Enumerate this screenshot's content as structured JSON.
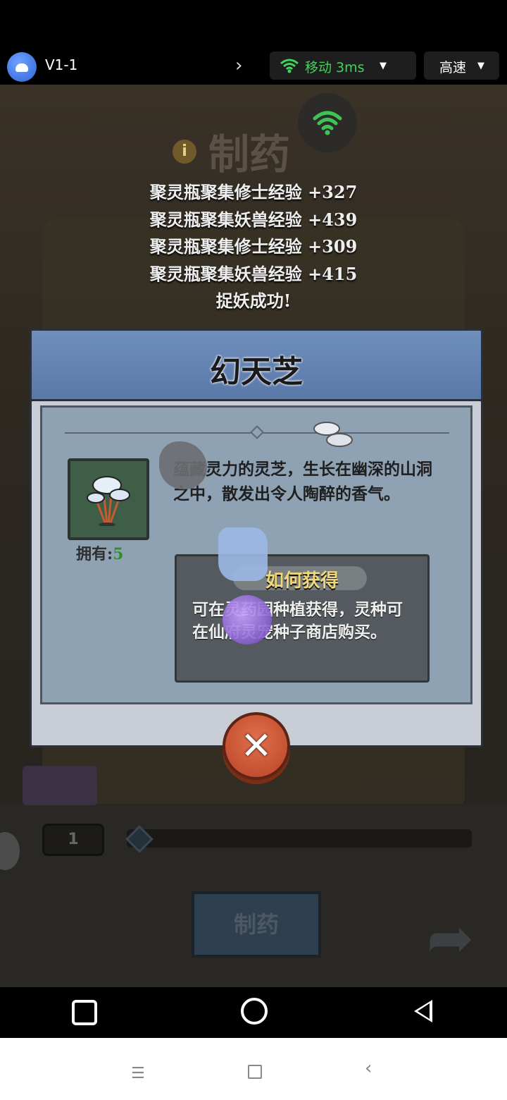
{
  "toolbar": {
    "session_name": "V1-1",
    "network_label": "移动 3ms",
    "speed_label": "高速",
    "colors": {
      "network_green": "#41d35b"
    }
  },
  "game": {
    "background_title": "制药",
    "info_symbol": "i",
    "log_lines": [
      "聚灵瓶聚集修士经验 +327",
      "聚灵瓶聚集妖兽经验 +439",
      "聚灵瓶聚集修士经验 +309",
      "聚灵瓶聚集妖兽经验 +415",
      "捉妖成功!"
    ],
    "quantity_value": "1",
    "make_button_label": "制药"
  },
  "item_card": {
    "title": "幻天芝",
    "owned_label": "拥有:",
    "owned_count": "5",
    "description": "蕴藏灵力的灵芝，生长在幽深的山洞之中，散发出令人陶醉的香气。",
    "how_to_obtain_label": "如何获得",
    "how_to_obtain_text": "可在灵药园种植获得，灵种可在仙府灵宠种子商店购买。",
    "close_symbol": "✕"
  },
  "nav": {
    "icons": [
      "recent-apps-icon",
      "home-icon",
      "back-icon"
    ]
  }
}
